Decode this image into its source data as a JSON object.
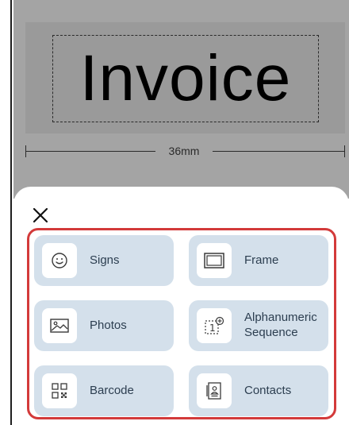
{
  "preview": {
    "label_text": "Invoice",
    "width_label": "36mm"
  },
  "sheet": {
    "close_icon": "close-icon",
    "tiles": [
      {
        "label": "Signs",
        "icon": "smiley-icon"
      },
      {
        "label": "Frame",
        "icon": "frame-icon"
      },
      {
        "label": "Photos",
        "icon": "photo-icon"
      },
      {
        "label": "Alphanumeric Sequence",
        "icon": "sequence-icon"
      },
      {
        "label": "Barcode",
        "icon": "barcode-icon"
      },
      {
        "label": "Contacts",
        "icon": "contacts-icon"
      }
    ]
  },
  "colors": {
    "canvas": "#a4a4a4",
    "label_preview": "#9a9a9a",
    "tile_bg": "#d4e0eb",
    "highlight": "#d33a3a"
  }
}
